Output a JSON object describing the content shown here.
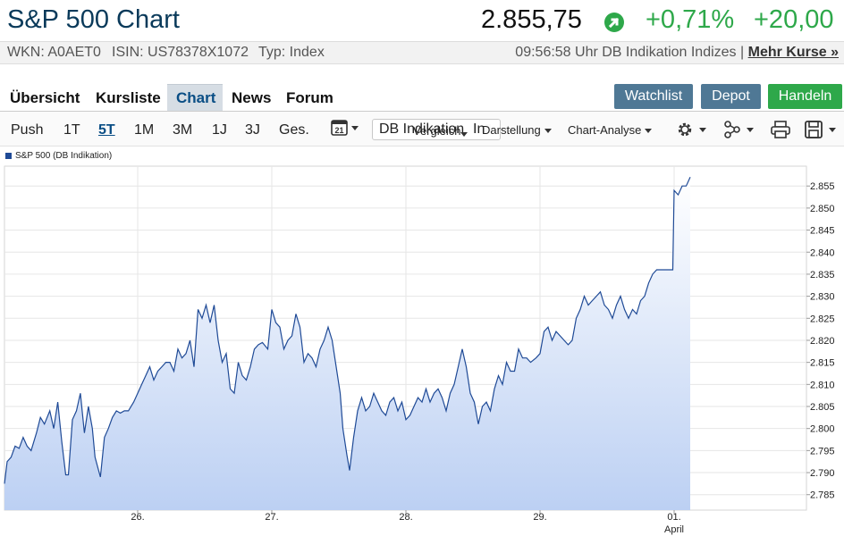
{
  "header": {
    "title": "S&P 500 Chart",
    "price": "2.855,75",
    "change_pct": "+0,71%",
    "change_abs": "+20,00"
  },
  "meta": {
    "wkn": "WKN: A0AET0",
    "isin": "ISIN: US78378X1072",
    "typ": "Typ: Index",
    "time_source": "09:56:58 Uhr DB Indikation Indizes",
    "separator": "|",
    "more_link": "Mehr Kurse »"
  },
  "nav": {
    "tabs": [
      "Übersicht",
      "Kursliste",
      "Chart",
      "News",
      "Forum"
    ],
    "active": "Chart",
    "buttons": {
      "watchlist": "Watchlist",
      "depot": "Depot",
      "handeln": "Handeln"
    }
  },
  "toolbar": {
    "ranges": [
      "Push",
      "1T",
      "5T",
      "1M",
      "3M",
      "1J",
      "3J",
      "Ges."
    ],
    "active_range": "5T",
    "calendar_day": "21",
    "source_value": "DB Indikation",
    "source_partial": "In",
    "overlap_text": "Vergleich",
    "darstellung": "Darstellung",
    "chart_analyse": "Chart-Analyse"
  },
  "colors": {
    "title": "#0a3a5a",
    "positive": "#2ea84a",
    "watchlist_btn": "#4f7895",
    "depot_btn": "#4f7895",
    "handeln_btn": "#2ea84a",
    "line": "#1f4a96",
    "area_top": "#ffffff",
    "area_bottom": "#bcd0f3"
  },
  "icons": [
    "arrow-up-right-icon",
    "calendar-icon",
    "gear-icon",
    "share-icon",
    "print-icon",
    "save-icon"
  ],
  "chart_data": {
    "type": "area",
    "legend": "S&P 500 (DB Indikation)",
    "x_ticks": [
      "26.",
      "27.",
      "28.",
      "29.",
      "01."
    ],
    "x_sublabel": "April",
    "y_ticks": [
      2.785,
      2.79,
      2.795,
      2.8,
      2.805,
      2.81,
      2.815,
      2.82,
      2.825,
      2.83,
      2.835,
      2.84,
      2.845,
      2.85,
      2.855
    ],
    "y_tick_labels": [
      "2.785",
      "2.790",
      "2.795",
      "2.800",
      "2.805",
      "2.810",
      "2.815",
      "2.820",
      "2.825",
      "2.830",
      "2.835",
      "2.840",
      "2.845",
      "2.850",
      "2.855"
    ],
    "ylim": [
      2.7815,
      2.8595
    ],
    "xlim": [
      0,
      5.12
    ],
    "grid": true,
    "series": [
      {
        "name": "S&P 500 (DB Indikation)",
        "points": [
          [
            0.0,
            2.7875
          ],
          [
            0.02,
            2.7925
          ],
          [
            0.05,
            2.7935
          ],
          [
            0.08,
            2.796
          ],
          [
            0.11,
            2.7955
          ],
          [
            0.14,
            2.798
          ],
          [
            0.17,
            2.796
          ],
          [
            0.2,
            2.795
          ],
          [
            0.24,
            2.799
          ],
          [
            0.27,
            2.8025
          ],
          [
            0.3,
            2.801
          ],
          [
            0.34,
            2.804
          ],
          [
            0.37,
            2.8
          ],
          [
            0.4,
            2.806
          ],
          [
            0.43,
            2.797
          ],
          [
            0.46,
            2.7895
          ],
          [
            0.48,
            2.7895
          ],
          [
            0.51,
            2.802
          ],
          [
            0.54,
            2.804
          ],
          [
            0.57,
            2.808
          ],
          [
            0.6,
            2.799
          ],
          [
            0.63,
            2.805
          ],
          [
            0.66,
            2.8
          ],
          [
            0.68,
            2.7935
          ],
          [
            0.72,
            2.789
          ],
          [
            0.75,
            2.798
          ],
          [
            0.78,
            2.8
          ],
          [
            0.81,
            2.8025
          ],
          [
            0.84,
            2.804
          ],
          [
            0.87,
            2.8035
          ],
          [
            0.9,
            2.804
          ],
          [
            0.93,
            2.804
          ],
          [
            0.97,
            2.806
          ],
          [
            1.0,
            2.808
          ],
          [
            1.03,
            2.81
          ],
          [
            1.06,
            2.812
          ],
          [
            1.09,
            2.814
          ],
          [
            1.12,
            2.811
          ],
          [
            1.15,
            2.813
          ],
          [
            1.18,
            2.814
          ],
          [
            1.21,
            2.815
          ],
          [
            1.24,
            2.815
          ],
          [
            1.27,
            2.813
          ],
          [
            1.3,
            2.818
          ],
          [
            1.33,
            2.816
          ],
          [
            1.36,
            2.817
          ],
          [
            1.39,
            2.82
          ],
          [
            1.42,
            2.814
          ],
          [
            1.45,
            2.827
          ],
          [
            1.48,
            2.825
          ],
          [
            1.51,
            2.828
          ],
          [
            1.54,
            2.824
          ],
          [
            1.57,
            2.828
          ],
          [
            1.6,
            2.82
          ],
          [
            1.63,
            2.815
          ],
          [
            1.66,
            2.817
          ],
          [
            1.69,
            2.809
          ],
          [
            1.72,
            2.808
          ],
          [
            1.75,
            2.815
          ],
          [
            1.78,
            2.812
          ],
          [
            1.81,
            2.811
          ],
          [
            1.84,
            2.814
          ],
          [
            1.87,
            2.818
          ],
          [
            1.9,
            2.819
          ],
          [
            1.93,
            2.8195
          ],
          [
            1.97,
            2.818
          ],
          [
            2.0,
            2.827
          ],
          [
            2.03,
            2.824
          ],
          [
            2.06,
            2.823
          ],
          [
            2.09,
            2.818
          ],
          [
            2.12,
            2.82
          ],
          [
            2.15,
            2.821
          ],
          [
            2.18,
            2.826
          ],
          [
            2.21,
            2.823
          ],
          [
            2.24,
            2.815
          ],
          [
            2.27,
            2.817
          ],
          [
            2.3,
            2.816
          ],
          [
            2.33,
            2.814
          ],
          [
            2.36,
            2.818
          ],
          [
            2.39,
            2.82
          ],
          [
            2.42,
            2.823
          ],
          [
            2.45,
            2.82
          ],
          [
            2.48,
            2.814
          ],
          [
            2.51,
            2.808
          ],
          [
            2.53,
            2.8
          ],
          [
            2.56,
            2.794
          ],
          [
            2.58,
            2.7905
          ],
          [
            2.61,
            2.798
          ],
          [
            2.64,
            2.804
          ],
          [
            2.67,
            2.807
          ],
          [
            2.7,
            2.804
          ],
          [
            2.73,
            2.805
          ],
          [
            2.76,
            2.808
          ],
          [
            2.79,
            2.806
          ],
          [
            2.82,
            2.804
          ],
          [
            2.85,
            2.803
          ],
          [
            2.88,
            2.806
          ],
          [
            2.91,
            2.807
          ],
          [
            2.94,
            2.804
          ],
          [
            2.97,
            2.806
          ],
          [
            3.0,
            2.802
          ],
          [
            3.03,
            2.803
          ],
          [
            3.06,
            2.805
          ],
          [
            3.09,
            2.807
          ],
          [
            3.12,
            2.806
          ],
          [
            3.15,
            2.809
          ],
          [
            3.18,
            2.806
          ],
          [
            3.21,
            2.808
          ],
          [
            3.24,
            2.809
          ],
          [
            3.27,
            2.807
          ],
          [
            3.3,
            2.804
          ],
          [
            3.33,
            2.808
          ],
          [
            3.36,
            2.81
          ],
          [
            3.39,
            2.814
          ],
          [
            3.42,
            2.818
          ],
          [
            3.45,
            2.814
          ],
          [
            3.48,
            2.808
          ],
          [
            3.51,
            2.806
          ],
          [
            3.54,
            2.801
          ],
          [
            3.57,
            2.805
          ],
          [
            3.6,
            2.806
          ],
          [
            3.63,
            2.804
          ],
          [
            3.66,
            2.809
          ],
          [
            3.69,
            2.812
          ],
          [
            3.72,
            2.81
          ],
          [
            3.75,
            2.815
          ],
          [
            3.78,
            2.813
          ],
          [
            3.81,
            2.813
          ],
          [
            3.84,
            2.818
          ],
          [
            3.87,
            2.816
          ],
          [
            3.9,
            2.816
          ],
          [
            3.93,
            2.815
          ],
          [
            3.97,
            2.816
          ],
          [
            4.0,
            2.817
          ],
          [
            4.03,
            2.822
          ],
          [
            4.06,
            2.823
          ],
          [
            4.09,
            2.82
          ],
          [
            4.12,
            2.822
          ],
          [
            4.15,
            2.821
          ],
          [
            4.18,
            2.82
          ],
          [
            4.21,
            2.819
          ],
          [
            4.24,
            2.82
          ],
          [
            4.27,
            2.825
          ],
          [
            4.3,
            2.827
          ],
          [
            4.33,
            2.83
          ],
          [
            4.36,
            2.828
          ],
          [
            4.39,
            2.829
          ],
          [
            4.42,
            2.83
          ],
          [
            4.45,
            2.831
          ],
          [
            4.48,
            2.828
          ],
          [
            4.51,
            2.827
          ],
          [
            4.54,
            2.825
          ],
          [
            4.57,
            2.828
          ],
          [
            4.6,
            2.83
          ],
          [
            4.63,
            2.827
          ],
          [
            4.66,
            2.825
          ],
          [
            4.69,
            2.827
          ],
          [
            4.72,
            2.826
          ],
          [
            4.75,
            2.829
          ],
          [
            4.78,
            2.83
          ],
          [
            4.81,
            2.833
          ],
          [
            4.84,
            2.835
          ],
          [
            4.87,
            2.836
          ],
          [
            4.9,
            2.836
          ],
          [
            4.93,
            2.836
          ],
          [
            4.97,
            2.836
          ],
          [
            4.99,
            2.836
          ],
          [
            5.0,
            2.854
          ],
          [
            5.03,
            2.853
          ],
          [
            5.06,
            2.855
          ],
          [
            5.09,
            2.855
          ],
          [
            5.12,
            2.857
          ]
        ]
      }
    ]
  }
}
